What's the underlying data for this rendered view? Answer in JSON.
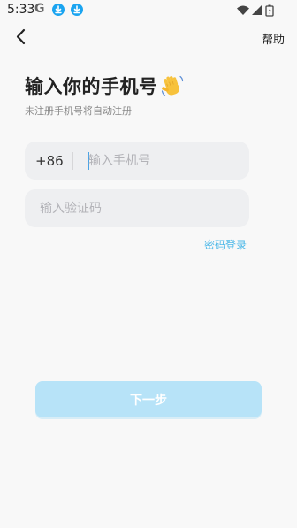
{
  "status_bar": {
    "time": "5:33",
    "app_letter": "G"
  },
  "header": {
    "help_label": "帮助"
  },
  "title": "输入你的手机号",
  "subtitle": "未注册手机号将自动注册",
  "phone": {
    "country_code": "+86",
    "placeholder": "输入手机号",
    "value": ""
  },
  "code": {
    "placeholder": "输入验证码",
    "value": ""
  },
  "password_login_label": "密码登录",
  "next_button_label": "下一步",
  "colors": {
    "accent": "#4cb8e8",
    "button_disabled": "#b7e3f8",
    "input_bg": "#eeeff1",
    "page_bg": "#f8f8f8"
  },
  "icons": {
    "back": "chevron-left-icon",
    "wave": "waving-hand-icon",
    "download": "download-icon",
    "wifi": "wifi-icon",
    "signal": "signal-icon",
    "battery": "battery-icon"
  }
}
